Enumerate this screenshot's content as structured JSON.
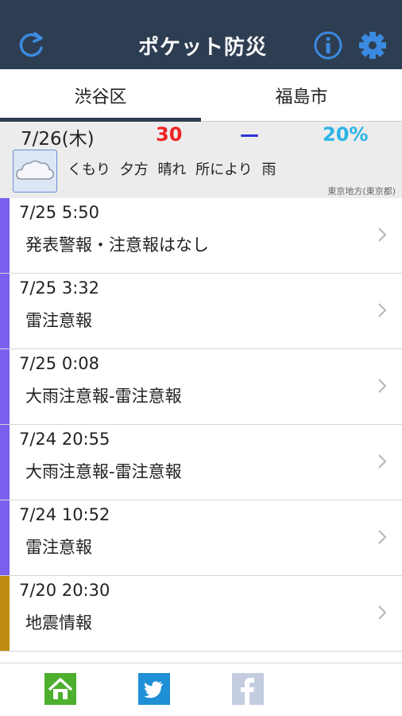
{
  "header": {
    "app_title": "ポケット防災",
    "colors": {
      "bar": "#2e3e52",
      "icon": "#3b8ae0"
    },
    "icons": {
      "refresh": "refresh-icon",
      "info": "info-icon",
      "settings": "gear-icon"
    }
  },
  "tabs": [
    {
      "label": "渋谷区",
      "selected": true
    },
    {
      "label": "福島市",
      "selected": false
    }
  ],
  "weather": {
    "date": "7/26(木)",
    "high": "30",
    "low": "—",
    "rain_chance": "20%",
    "icon": "cloud-icon",
    "description": "くもり 夕方 晴れ 所により 雨",
    "region": "東京地方(東京都)"
  },
  "alerts": [
    {
      "time": "7/25 5:50",
      "title": "発表警報・注意報はなし",
      "color": "#7b5ff0"
    },
    {
      "time": "7/25 3:32",
      "title": "雷注意報",
      "color": "#7b5ff0"
    },
    {
      "time": "7/25 0:08",
      "title": "大雨注意報-雷注意報",
      "color": "#7b5ff0"
    },
    {
      "time": "7/24 20:55",
      "title": "大雨注意報-雷注意報",
      "color": "#7b5ff0"
    },
    {
      "time": "7/24 10:52",
      "title": "雷注意報",
      "color": "#7b5ff0"
    },
    {
      "time": "7/20 20:30",
      "title": "地震情報",
      "color": "#bf8b12"
    }
  ],
  "footer": {
    "buttons": [
      {
        "icon": "home-icon",
        "color": "#4caf2e"
      },
      {
        "icon": "twitter-icon",
        "color": "#1f8fd6"
      },
      {
        "icon": "facebook-icon",
        "color": "#c4cce0"
      }
    ]
  }
}
